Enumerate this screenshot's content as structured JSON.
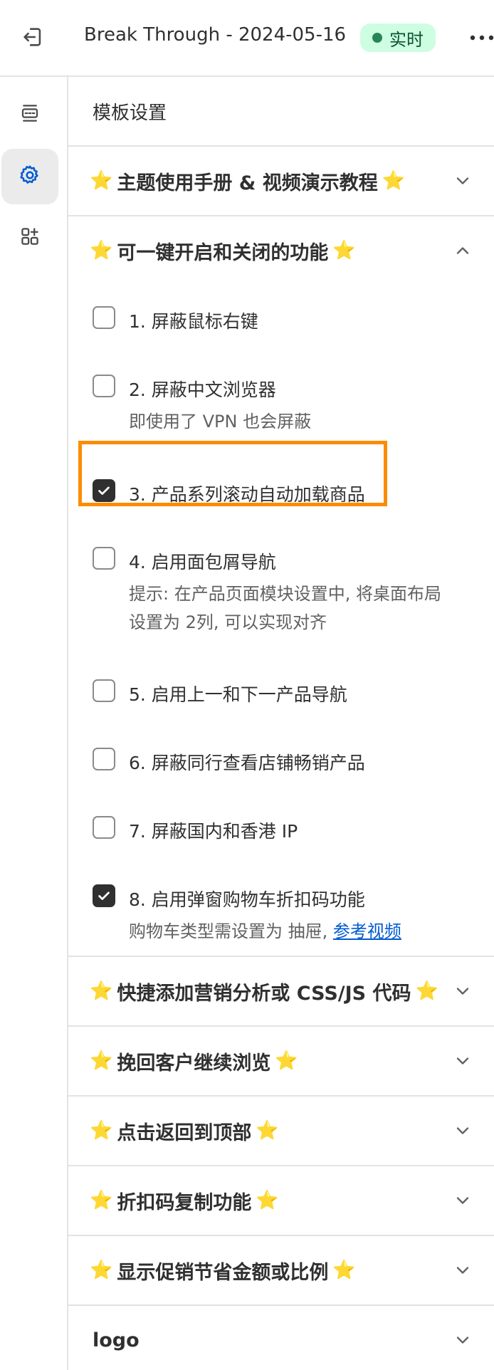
{
  "topbar": {
    "title": "Break Through - 2024-05-16",
    "status_badge": "实时"
  },
  "sidebar": {
    "items": [
      {
        "name": "sections-icon"
      },
      {
        "name": "settings-icon",
        "active": true
      },
      {
        "name": "apps-icon"
      }
    ]
  },
  "panel": {
    "title": "模板设置",
    "star": "⭐",
    "sections": [
      {
        "label": "主题使用手册 & 视频演示教程",
        "expanded": false
      },
      {
        "label": "可一键开启和关闭的功能",
        "expanded": true
      },
      {
        "label": "快捷添加营销分析或 CSS/JS 代码",
        "expanded": false
      },
      {
        "label": "挽回客户继续浏览",
        "expanded": false
      },
      {
        "label": "点击返回到顶部",
        "expanded": false
      },
      {
        "label": "折扣码复制功能",
        "expanded": false
      },
      {
        "label": "显示促销节省金额或比例",
        "expanded": false
      },
      {
        "label": "logo",
        "expanded": false
      }
    ],
    "options": [
      {
        "label": "1. 屏蔽鼠标右键",
        "checked": false
      },
      {
        "label": "2. 屏蔽中文浏览器",
        "checked": false,
        "hint": "即使用了 VPN 也会屏蔽"
      },
      {
        "label": "3. 产品系列滚动自动加载商品",
        "checked": true
      },
      {
        "label": "4. 启用面包屑导航",
        "checked": false,
        "hint_line1": "提示: 在产品页面模块设置中, 将桌面布局",
        "hint_line2": "设置为 2列, 可以实现对齐"
      },
      {
        "label": "5. 启用上一和下一产品导航",
        "checked": false
      },
      {
        "label": "6. 屏蔽同行查看店铺畅销产品",
        "checked": false
      },
      {
        "label": "7. 屏蔽国内和香港 IP",
        "checked": false
      },
      {
        "label": "8. 启用弹窗购物车折扣码功能",
        "checked": true,
        "hint": "购物车类型需设置为 抽屉, ",
        "link": "参考视频"
      }
    ]
  },
  "colors": {
    "accent": "#005bd3",
    "badge_bg": "#cdfee1",
    "badge_dot": "#29845a",
    "highlight": "#fb8c00",
    "star": "#f5b400"
  }
}
